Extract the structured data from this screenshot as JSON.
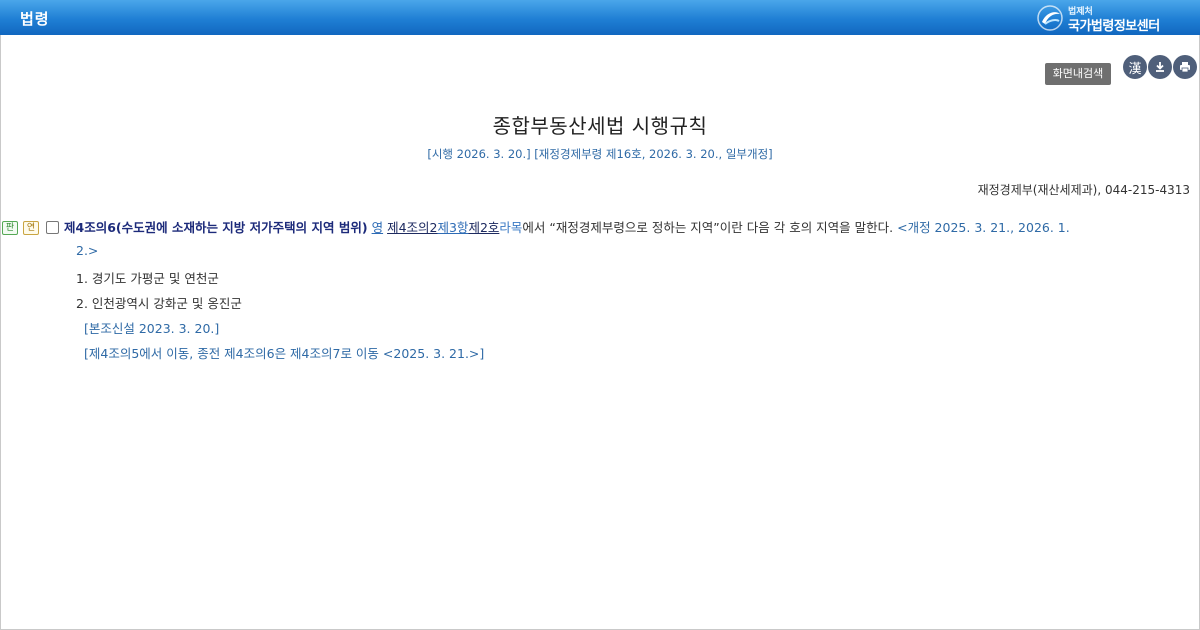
{
  "topbar": {
    "title": "법령"
  },
  "logo": {
    "small": "법제처",
    "big": "국가법령정보센터"
  },
  "toolbar": {
    "search_label": "화면내검색",
    "hanja_label": "漢",
    "download_icon": "download-icon",
    "print_icon": "print-icon"
  },
  "document": {
    "title": "종합부동산세법 시행규칙",
    "subtitle": "[시행 2026. 3. 20.] [재정경제부령 제16호, 2026. 3. 20., 일부개정]",
    "ministry": "재정경제부(재산세제과), 044-215-4313"
  },
  "article": {
    "badges": [
      "판",
      "연"
    ],
    "heading": "제4조의6(수도권에 소재하는 지방 저가주택의 지역 범위)",
    "ref_yeong": "영",
    "ref_jo": "제4조의2",
    "ref_hang": "제3항",
    "ref_ho": "제2호",
    "ref_mok": "라목",
    "body": "에서 “재정경제부령으로 정하는 지역”이란 다음 각 호의 지역을 말한다.",
    "amend_start": "<개정 2025. 3. 21., 2026. 1.",
    "amend_end": "2.>",
    "items": [
      "1. 경기도 가평군 및 연천군",
      "2. 인천광역시 강화군 및 옹진군"
    ],
    "notes": [
      "[본조신설 2023. 3. 20.]",
      "[제4조의5에서 이동, 종전 제4조의6은 제4조의7로 이동 <2025. 3. 21.>]"
    ]
  },
  "colors": {
    "topbar": "#1f7fd4",
    "link": "#2d6bb5",
    "heading": "#1c2a7a"
  }
}
